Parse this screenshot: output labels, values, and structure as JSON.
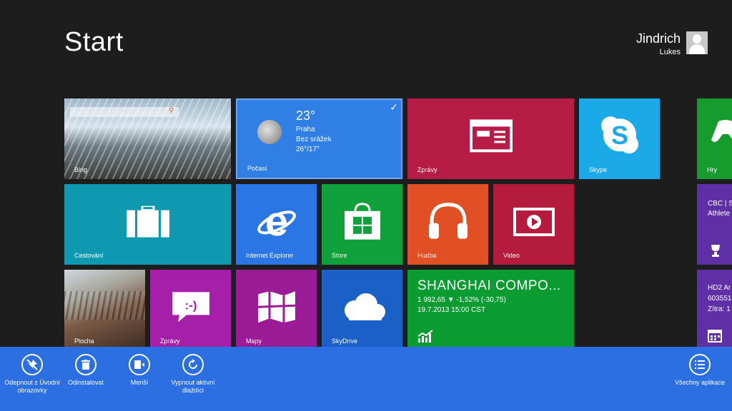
{
  "screen": {
    "title": "Start"
  },
  "user": {
    "first_name": "Jindrich",
    "last_name": "Lukes"
  },
  "tiles": {
    "bing": {
      "label": "Bing"
    },
    "weather": {
      "label": "Počasí",
      "temperature": "23°",
      "city": "Praha",
      "condition": "Bez srážek",
      "range": "26°/17°"
    },
    "news": {
      "label": "Zprávy"
    },
    "skype": {
      "label": "Skype"
    },
    "games": {
      "label": "Hry"
    },
    "travel": {
      "label": "Cestování"
    },
    "ie": {
      "label": "Internet Explorer"
    },
    "store": {
      "label": "Store"
    },
    "music": {
      "label": "Hudba"
    },
    "video": {
      "label": "Video"
    },
    "sport": {
      "line1": "CBC | S",
      "line2": "Athlete"
    },
    "desktop": {
      "label": "Plocha"
    },
    "messaging": {
      "label": "Zprávy"
    },
    "maps": {
      "label": "Mapy"
    },
    "skydrive": {
      "label": "SkyDrive"
    },
    "finance": {
      "title": "SHANGHAI COMPO...",
      "quote": "1 992,65  ▼ -1,52% (-30,75)",
      "timestamp": "19.7.2013 15:00 CST"
    },
    "calendar": {
      "line1": "HD2 Ar",
      "line2": "603551",
      "line3": "Zítra: 1"
    }
  },
  "appbar": {
    "unpin_label": "Odepnout z Úvodní obrazovky",
    "uninstall_label": "Odinstalovat",
    "smaller_label": "Menší",
    "live_off_label": "Vypnout aktivní dlaždici",
    "all_apps_label": "Všechny aplikace"
  },
  "colors": {
    "background": "#1d1d1d",
    "weather": "#2f7fe4",
    "news": "#b71c46",
    "skype": "#1ba9e8",
    "games": "#159c2c",
    "travel": "#0e99b0",
    "ie": "#2a76e4",
    "store": "#10a13b",
    "music": "#e14f24",
    "video": "#b51b3c",
    "messaging": "#a51fa8",
    "maps": "#9b1a96",
    "skydrive": "#1b60c6",
    "finance": "#0b9c31",
    "appbar": "#2b6fe3"
  }
}
